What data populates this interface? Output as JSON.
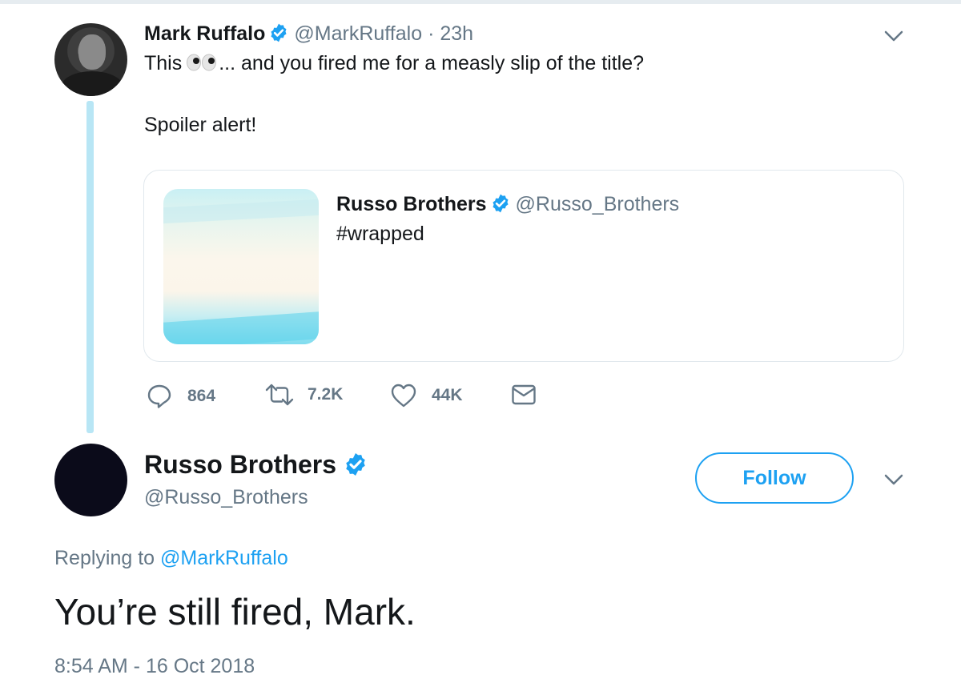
{
  "parent_tweet": {
    "author_name": "Mark Ruffalo",
    "handle": "@MarkRuffalo",
    "separator": "·",
    "time": "23h",
    "text_before_emoji": "This",
    "emoji_icon": "eyes-emoji",
    "text_after_emoji": "... and you fired me for a measly slip of the title?",
    "text_line2": "Spoiler alert!",
    "quoted_tweet": {
      "author_name": "Russo Brothers",
      "handle": "@Russo_Brothers",
      "text": "#wrapped"
    },
    "actions": {
      "replies": "864",
      "retweets": "7.2K",
      "likes": "44K"
    }
  },
  "main_tweet": {
    "author_name": "Russo Brothers",
    "handle": "@Russo_Brothers",
    "follow_label": "Follow",
    "replying_prefix": "Replying to",
    "replying_to": "@MarkRuffalo",
    "text": "You’re still fired, Mark.",
    "timestamp": "8:54 AM - 16 Oct 2018"
  },
  "colors": {
    "accent": "#1da1f2",
    "text_primary": "#14171a",
    "text_secondary": "#657786",
    "thread_line": "#b8e6f5",
    "border": "#e1e8ed"
  }
}
